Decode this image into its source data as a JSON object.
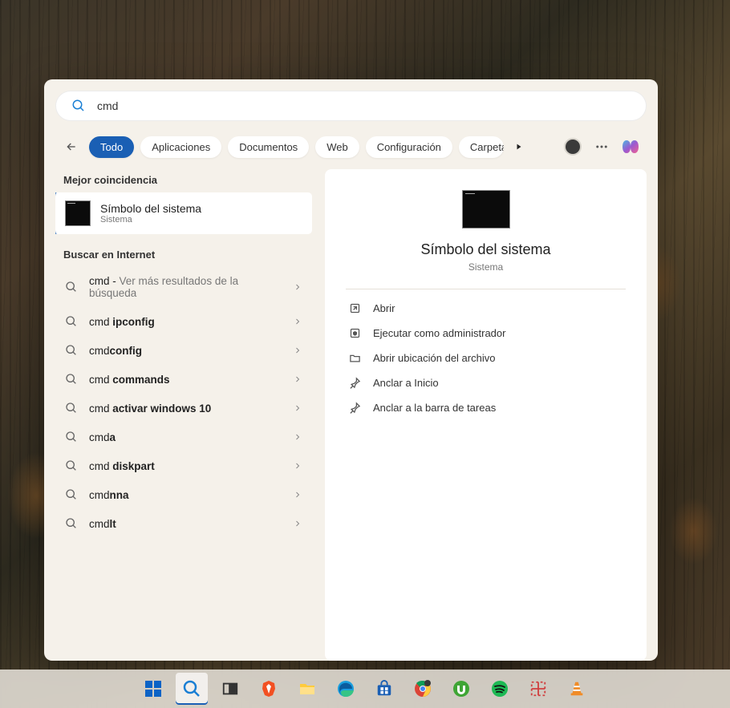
{
  "search": {
    "value": "cmd"
  },
  "tabs": {
    "active": "Todo",
    "items": [
      "Aplicaciones",
      "Documentos",
      "Web",
      "Configuración",
      "Carpetas"
    ]
  },
  "left": {
    "bestMatchLabel": "Mejor coincidencia",
    "bestItem": {
      "title": "Símbolo del sistema",
      "sub": "Sistema"
    },
    "webLabel": "Buscar en Internet",
    "suggestions": [
      {
        "prefix": "cmd",
        "suffix": " - ",
        "gray": "Ver más resultados de la búsqueda"
      },
      {
        "prefix": "cmd ",
        "bold": "ipconfig"
      },
      {
        "prefix": "cmd",
        "bold": "config"
      },
      {
        "prefix": "cmd ",
        "bold": "commands"
      },
      {
        "prefix": "cmd ",
        "bold": "activar windows 10"
      },
      {
        "prefix": "cmd",
        "bold": "a"
      },
      {
        "prefix": "cmd ",
        "bold": "diskpart"
      },
      {
        "prefix": "cmd",
        "bold": "nna"
      },
      {
        "prefix": "cmd",
        "bold": "lt"
      }
    ]
  },
  "detail": {
    "title": "Símbolo del sistema",
    "sub": "Sistema",
    "actions": [
      {
        "icon": "open",
        "label": "Abrir"
      },
      {
        "icon": "shield",
        "label": "Ejecutar como administrador"
      },
      {
        "icon": "folder",
        "label": "Abrir ubicación del archivo"
      },
      {
        "icon": "pin",
        "label": "Anclar a Inicio"
      },
      {
        "icon": "pin",
        "label": "Anclar a la barra de tareas"
      }
    ]
  },
  "taskbar": {
    "items": [
      "start",
      "search",
      "taskview",
      "brave",
      "explorer",
      "edge",
      "store",
      "chrome",
      "utorrent",
      "spotify",
      "snip",
      "vlc"
    ]
  }
}
